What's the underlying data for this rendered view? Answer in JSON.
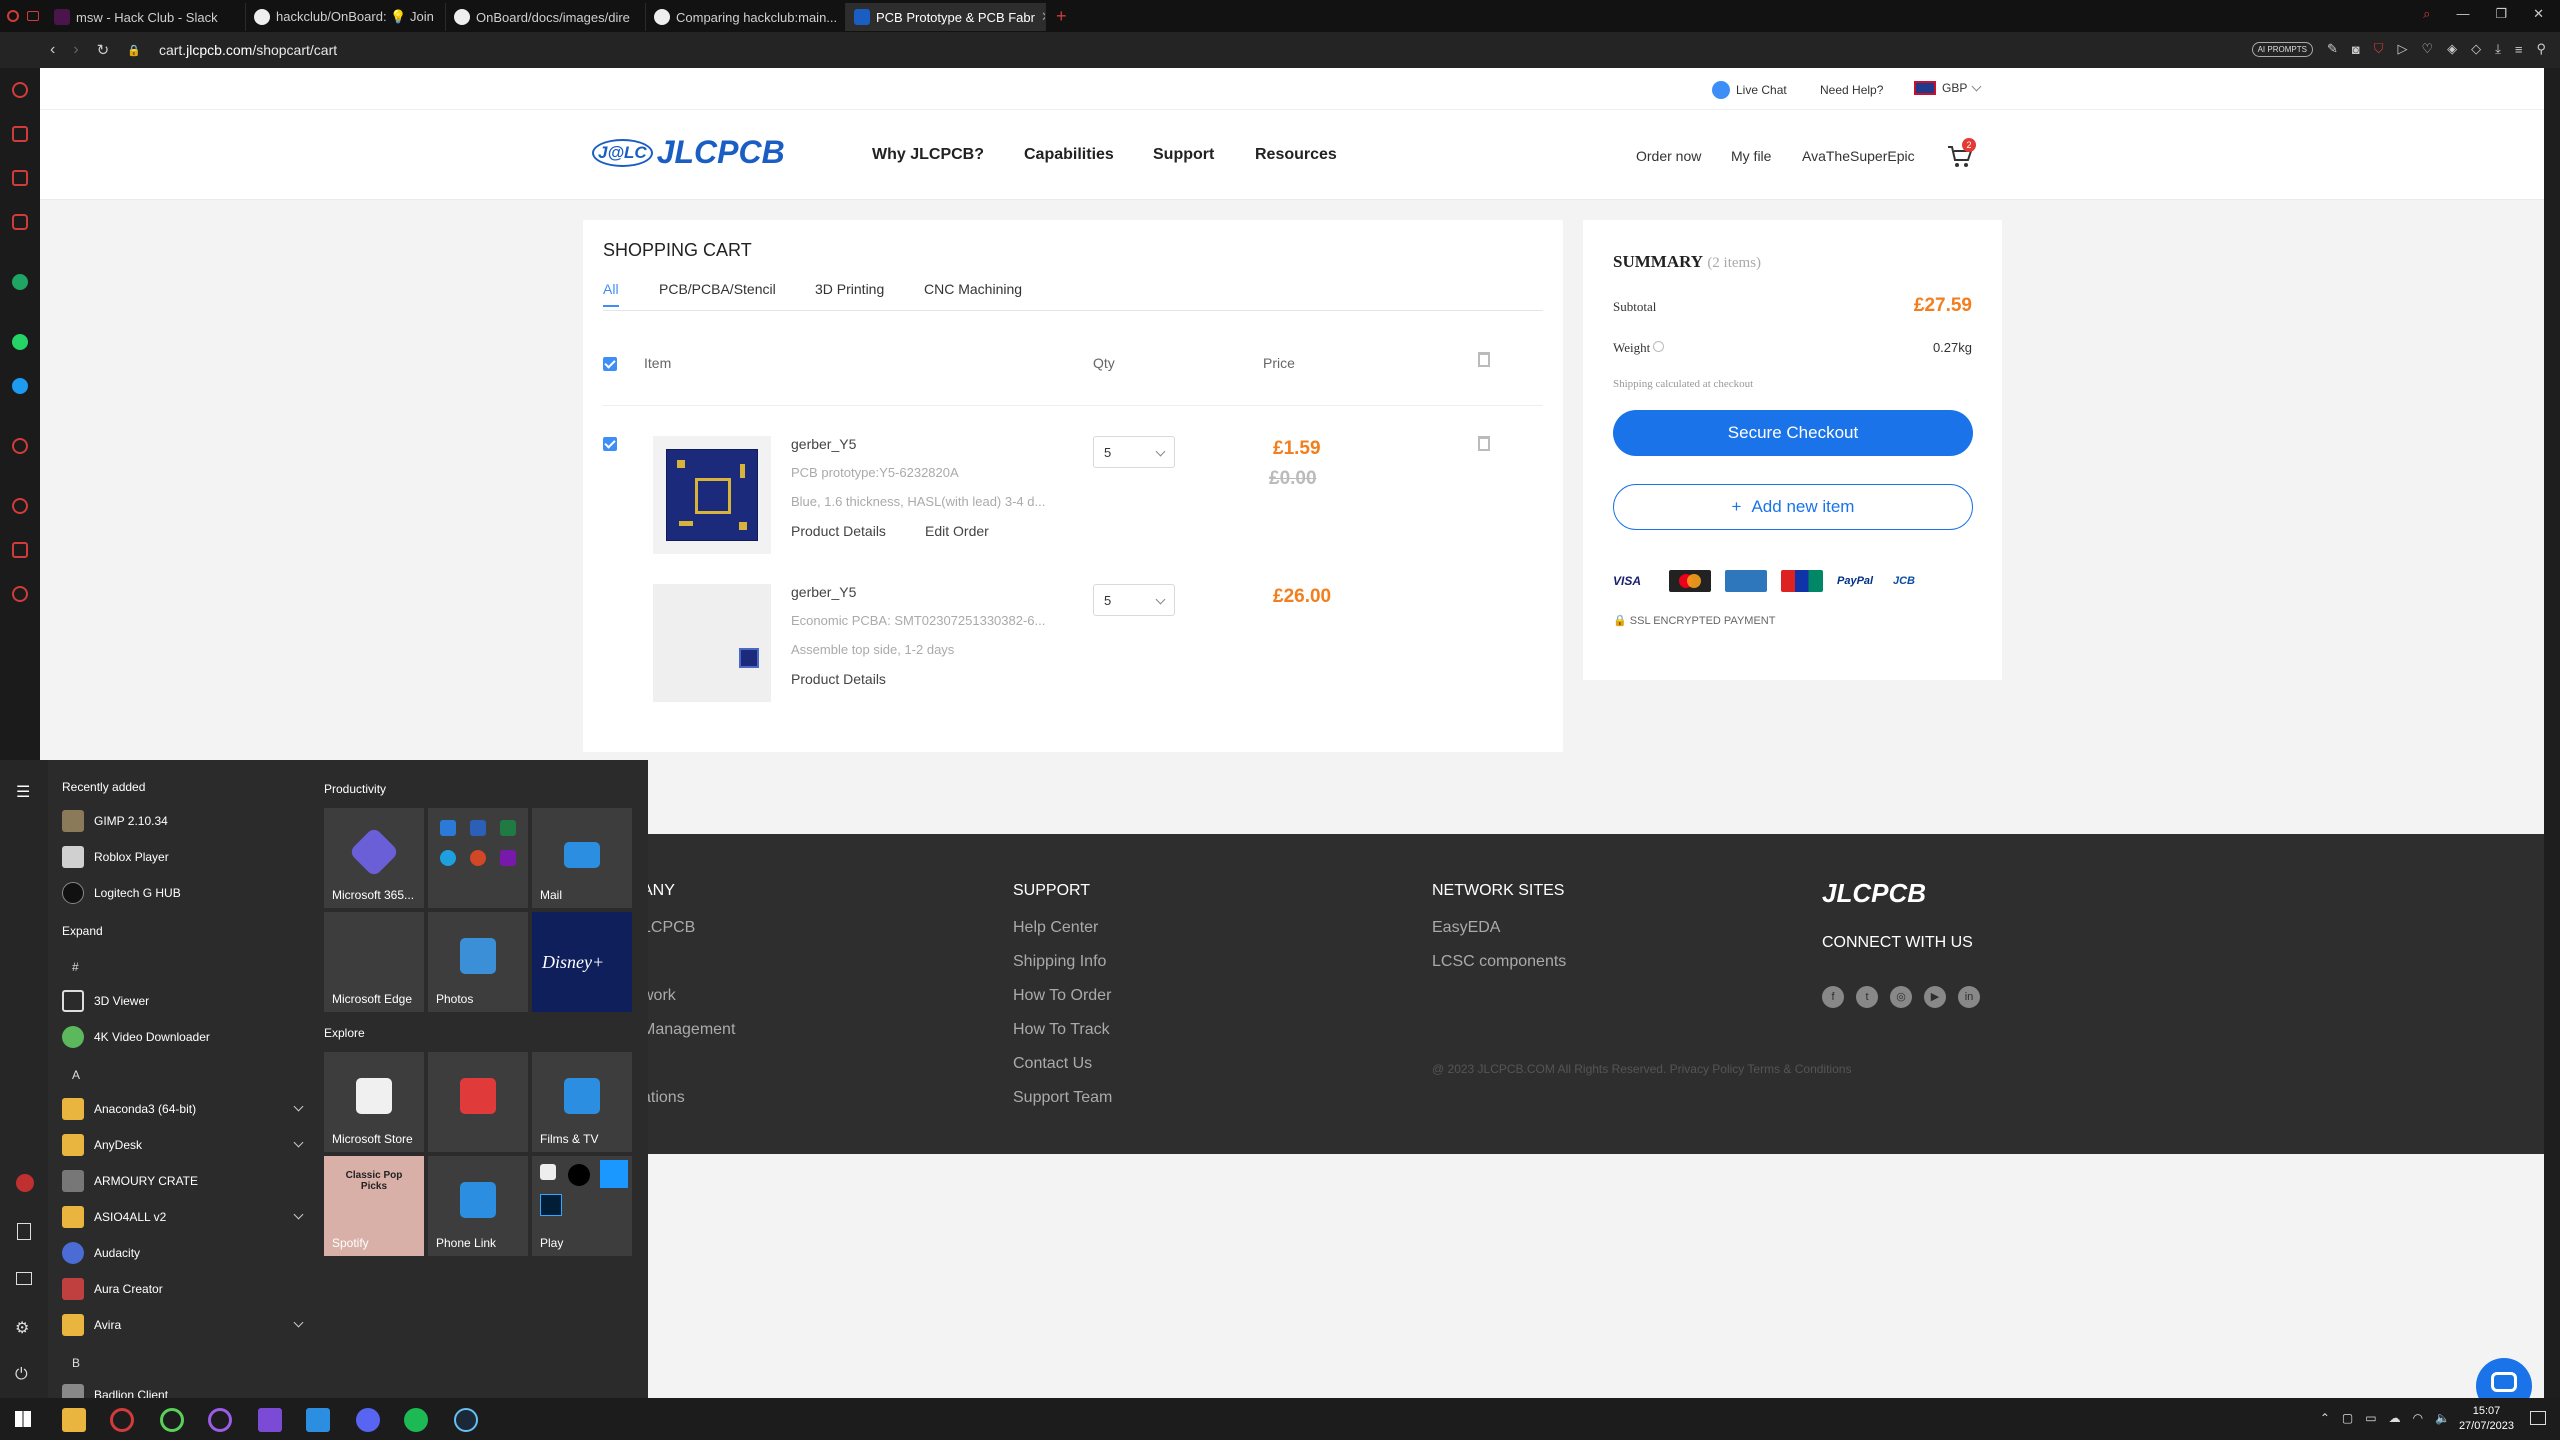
{
  "browser": {
    "tabs": [
      {
        "label": "msw - Hack Club - Slack",
        "icon": "slack-icon"
      },
      {
        "label": "hackclub/OnBoard: 💡 Join",
        "icon": "github-icon"
      },
      {
        "label": "OnBoard/docs/images/dire",
        "icon": "github-icon"
      },
      {
        "label": "Comparing hackclub:main...",
        "icon": "github-icon"
      },
      {
        "label": "PCB Prototype & PCB Fabr",
        "icon": "jlc-icon",
        "active": true
      }
    ],
    "new_tab": "+",
    "url_prefix": "cart.",
    "url_domain": "jlcpcb.com",
    "url_path": "/shopcart/cart",
    "ai_prompts": "AI PROMPTS"
  },
  "site": {
    "topstrip": {
      "live_chat": "Live Chat",
      "need_help": "Need Help?",
      "currency": "GBP"
    },
    "logo": "JLCPCB",
    "logo_prefix": "J@LC",
    "nav": [
      "Why JLCPCB?",
      "Capabilities",
      "Support",
      "Resources"
    ],
    "header_links": [
      "Order now",
      "My file",
      "AvaTheSuperEpic"
    ],
    "cart_count": "2"
  },
  "cart": {
    "title": "SHOPPING CART",
    "tabs": [
      "All",
      "PCB/PCBA/Stencil",
      "3D Printing",
      "CNC Machining"
    ],
    "columns": {
      "item": "Item",
      "qty": "Qty",
      "price": "Price"
    },
    "items": [
      {
        "name": "gerber_Y5",
        "type": "PCB prototype:Y5-6232820A",
        "desc": "Blue, 1.6 thickness, HASL(with lead) 3-4 d...",
        "links": [
          "Product Details",
          "Edit Order"
        ],
        "qty": "5",
        "price": "£1.59",
        "old_price": "£0.00"
      },
      {
        "name": "gerber_Y5",
        "type": "Economic PCBA: SMT02307251330382-6...",
        "desc": "Assemble top side, 1-2 days",
        "links": [
          "Product Details"
        ],
        "qty": "5",
        "price": "£26.00"
      }
    ]
  },
  "summary": {
    "title": "SUMMARY",
    "count": "(2 items)",
    "subtotal_label": "Subtotal",
    "subtotal": "£27.59",
    "weight_label": "Weight",
    "weight": "0.27kg",
    "shipping_note": "Shipping calculated at checkout",
    "checkout": "Secure Checkout",
    "add_item": "Add new item",
    "add_plus": "+",
    "payments": [
      "VISA",
      "MasterCard",
      "AMEX",
      "UnionPay",
      "PayPal",
      "JCB"
    ],
    "ssl": "SSL ENCRYPTED PAYMENT"
  },
  "footer": {
    "col1_head": "ANY",
    "col1_links": [
      "LCPCB",
      "",
      "work",
      "Management",
      "",
      "ations"
    ],
    "support_head": "SUPPORT",
    "support_links": [
      "Help Center",
      "Shipping Info",
      "How To Order",
      "How To Track",
      "Contact Us",
      "Support Team"
    ],
    "network_head": "NETWORK SITES",
    "network_links": [
      "EasyEDA",
      "LCSC components"
    ],
    "logo": "JLCPCB",
    "connect": "CONNECT WITH US",
    "social": [
      "facebook-icon",
      "twitter-icon",
      "instagram-icon",
      "youtube-icon",
      "linkedin-icon"
    ],
    "copyright": "@ 2023 JLCPCB.COM All Rights Reserved. Privacy Policy Terms & Conditions"
  },
  "startmenu": {
    "recently_added": "Recently added",
    "recent_apps": [
      {
        "label": "GIMP 2.10.34",
        "color": "#8a7a5a"
      },
      {
        "label": "Roblox Player",
        "color": "#d0d0d0"
      },
      {
        "label": "Logitech G HUB",
        "color": "#111111"
      }
    ],
    "expand": "Expand",
    "hash": "#",
    "hash_apps": [
      {
        "label": "3D Viewer",
        "color": "#666666"
      },
      {
        "label": "4K Video Downloader",
        "color": "#5cb85c"
      }
    ],
    "letter_a": "A",
    "a_apps": [
      {
        "label": "Anaconda3 (64-bit)",
        "color": "#e9b53f",
        "expand": true
      },
      {
        "label": "AnyDesk",
        "color": "#e9b53f",
        "expand": true
      },
      {
        "label": "ARMOURY CRATE",
        "color": "#777777"
      },
      {
        "label": "ASIO4ALL v2",
        "color": "#e9b53f",
        "expand": true
      },
      {
        "label": "Audacity",
        "color": "#4a6cd4"
      },
      {
        "label": "Aura Creator",
        "color": "#c04040"
      },
      {
        "label": "Avira",
        "color": "#e9b53f",
        "expand": true
      }
    ],
    "letter_b": "B",
    "b_apps": [
      {
        "label": "Badlion Client",
        "color": "#888888"
      }
    ],
    "productivity": "Productivity",
    "explore": "Explore",
    "tiles": [
      {
        "label": "Microsoft 365...",
        "color": "#6a5fd6"
      },
      {
        "label": "",
        "color": "#2b7bd6"
      },
      {
        "label": "Mail",
        "color": "#2b8ee0"
      },
      {
        "label": "Microsoft Edge",
        "color": "#3d3d3d"
      },
      {
        "label": "Photos",
        "color": "#3a8fd6"
      },
      {
        "label": "Disney+",
        "color": "#0f1f5c"
      },
      {
        "label": "Microsoft Store",
        "color": "#f0f0f0"
      },
      {
        "label": "",
        "color": "#e03a3a"
      },
      {
        "label": "Films & TV",
        "color": "#2b8ee0"
      },
      {
        "label": "Spotify",
        "color": "#d8b0a8"
      },
      {
        "label": "Phone Link",
        "color": "#2b8ee0"
      },
      {
        "label": "Play",
        "color": "#3d3d3d"
      }
    ],
    "pop_picks": "Classic Pop Picks"
  },
  "taskbar": {
    "time": "15:07",
    "date": "27/07/2023",
    "icons": [
      "windows-start-icon",
      "file-explorer-icon",
      "opera-icon",
      "opera-gx-icon",
      "tor-icon",
      "visual-studio-icon",
      "vscode-icon",
      "discord-icon",
      "spotify-icon",
      "steam-icon"
    ]
  }
}
